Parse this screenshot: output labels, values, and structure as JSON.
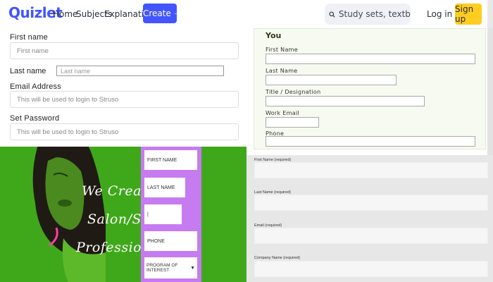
{
  "nav": {
    "logo": "Quizlet",
    "links": [
      "Home",
      "Subjects",
      "Explanations"
    ],
    "create_label": "Create",
    "search_placeholder": "Study sets, textbooks, ...",
    "login_label": "Log in",
    "signup_label": "Sign up",
    "brand_color": "#4255ff",
    "signup_color": "#ffcd1f"
  },
  "form_a": {
    "first_name_label": "First name",
    "first_name_placeholder": "First name",
    "last_name_label": "Last name",
    "last_name_placeholder": "Last name",
    "email_label": "Email Address",
    "email_placeholder": "This will be used to login to Struso",
    "password_label": "Set Password",
    "password_placeholder": "This will be used to login to Struso"
  },
  "form_b": {
    "title": "You",
    "labels": [
      "First Name",
      "Last Name",
      "Title / Designation",
      "Work Email",
      "Phone"
    ]
  },
  "form_c": {
    "headline_lines": [
      "We Create",
      "Salon/Spa",
      "Professionals"
    ],
    "fields": [
      "FIRST NAME",
      "LAST NAME",
      "|",
      "PHONE"
    ],
    "select_label": "PROGRAM OF INTEREST",
    "bg_color": "#3fa81a",
    "form_color": "#c77bf0"
  },
  "form_d": {
    "labels": [
      "First Name (required)",
      "Last Name (required)",
      "Email (required)",
      "Company Name (required)"
    ]
  }
}
